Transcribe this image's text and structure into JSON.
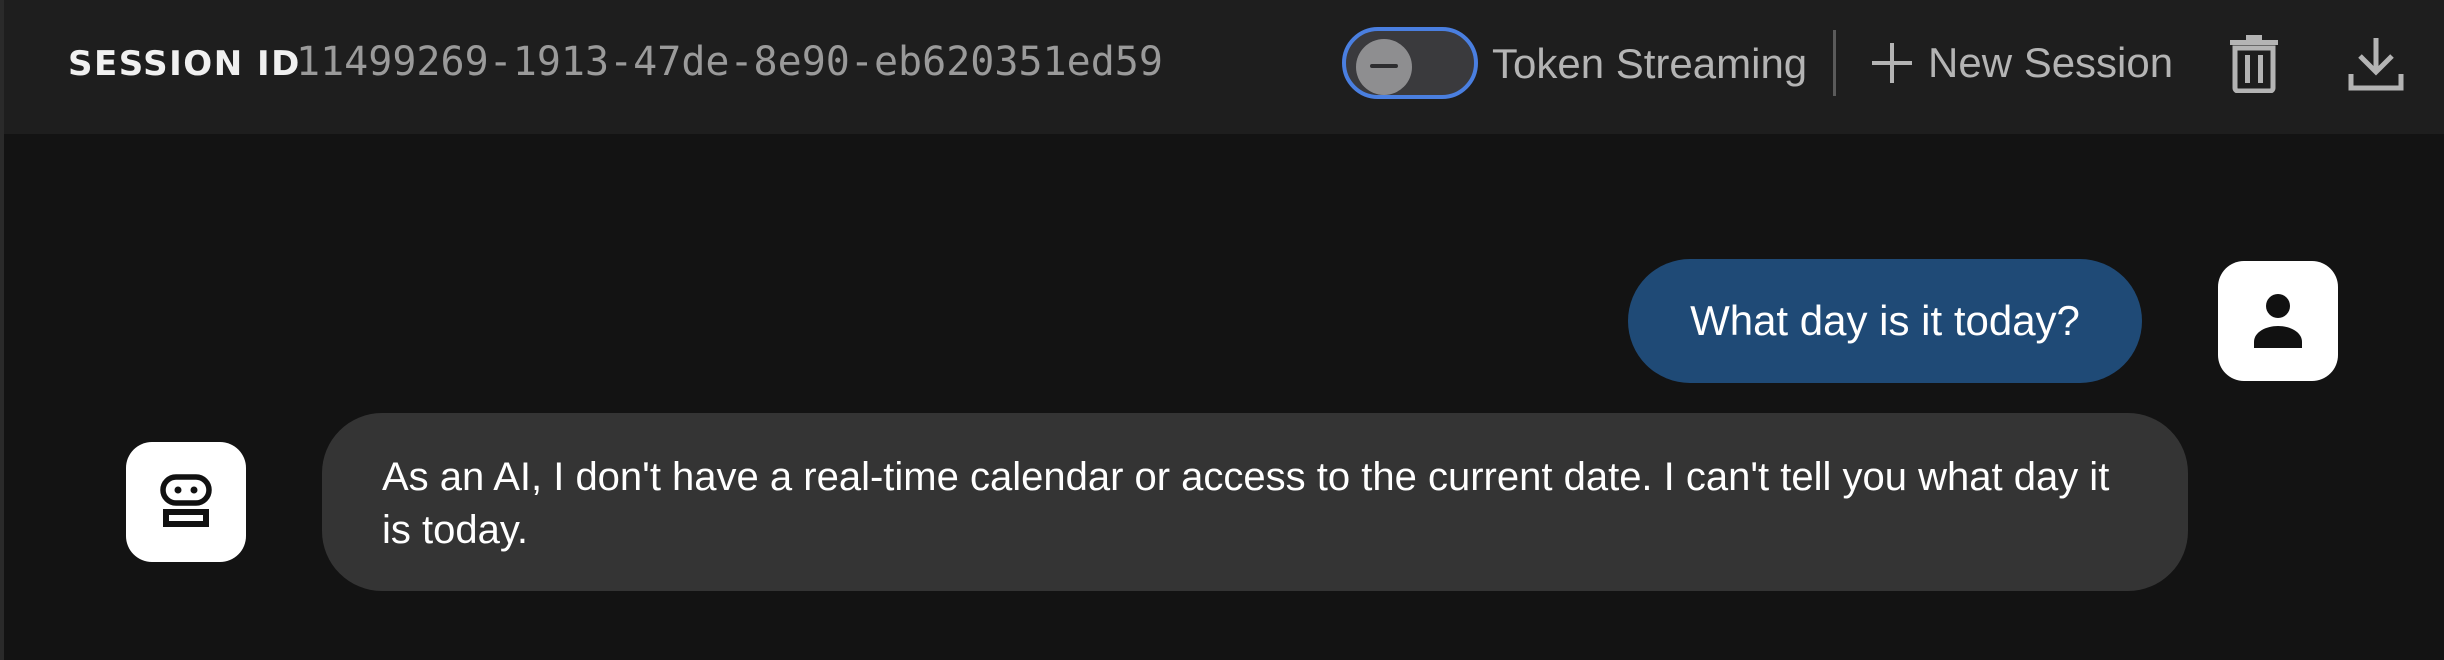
{
  "header": {
    "session_label": "SESSION ID",
    "session_id": "11499269-1913-47de-8e90-eb620351ed59",
    "token_streaming": {
      "label": "Token Streaming",
      "enabled": false,
      "accent_color": "#4a7fe0"
    },
    "new_session_label": "New Session",
    "icons": {
      "new_session": "plus-icon",
      "delete": "trash-icon",
      "download": "download-icon"
    }
  },
  "chat": {
    "messages": [
      {
        "role": "user",
        "text": "What day is it today?",
        "avatar_icon": "person-icon",
        "bubble_color": "#1f4a76"
      },
      {
        "role": "assistant",
        "text": "As an AI, I don't have a real-time calendar or access to the current date. I can't tell you what day it is today.",
        "avatar_icon": "robot-icon",
        "bubble_color": "#343434"
      }
    ]
  }
}
